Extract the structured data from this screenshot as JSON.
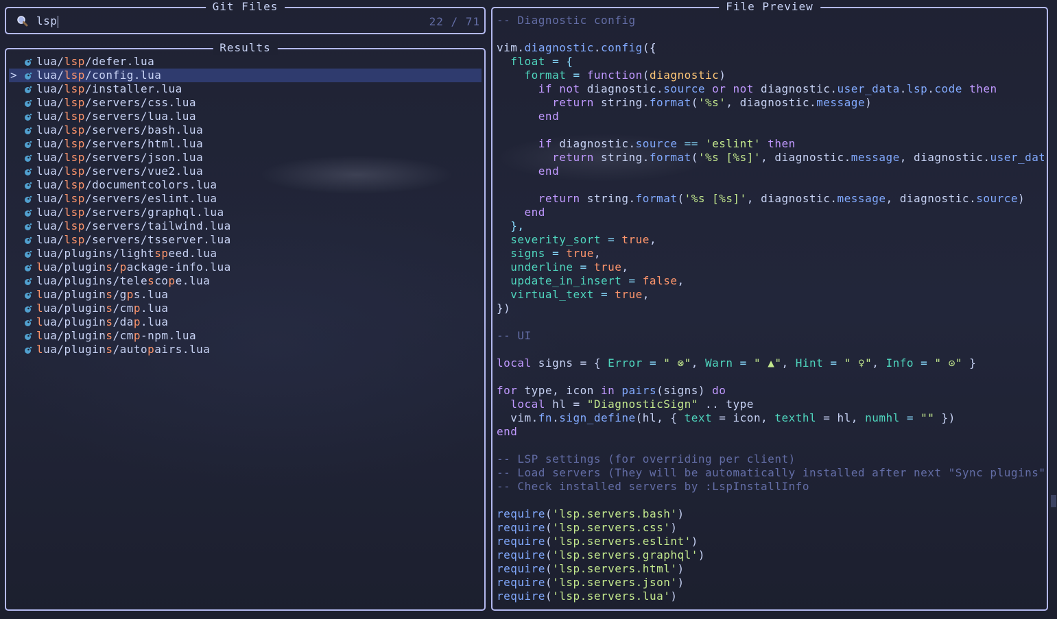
{
  "prompt": {
    "title": "Git Files",
    "query": "lsp",
    "counter": "22 / 71"
  },
  "results": {
    "title": "Results",
    "selected_index": 1,
    "items": [
      {
        "pre": "lua/",
        "hl": "lsp",
        "post": "/defer.lua"
      },
      {
        "pre": "lua/",
        "hl": "lsp",
        "post": "/config.lua"
      },
      {
        "pre": "lua/",
        "hl": "lsp",
        "post": "/installer.lua"
      },
      {
        "pre": "lua/",
        "hl": "lsp",
        "post": "/servers/css.lua"
      },
      {
        "pre": "lua/",
        "hl": "lsp",
        "post": "/servers/lua.lua"
      },
      {
        "pre": "lua/",
        "hl": "lsp",
        "post": "/servers/bash.lua"
      },
      {
        "pre": "lua/",
        "hl": "lsp",
        "post": "/servers/html.lua"
      },
      {
        "pre": "lua/",
        "hl": "lsp",
        "post": "/servers/json.lua"
      },
      {
        "pre": "lua/",
        "hl": "lsp",
        "post": "/servers/vue2.lua"
      },
      {
        "pre": "lua/",
        "hl": "lsp",
        "post": "/documentcolors.lua"
      },
      {
        "pre": "lua/",
        "hl": "lsp",
        "post": "/servers/eslint.lua"
      },
      {
        "pre": "lua/",
        "hl": "lsp",
        "post": "/servers/graphql.lua"
      },
      {
        "pre": "lua/",
        "hl": "lsp",
        "post": "/servers/tailwind.lua"
      },
      {
        "pre": "lua/",
        "hl": "lsp",
        "post": "/servers/tsserver.lua"
      },
      {
        "segs": [
          [
            "lua/plugins/light",
            0
          ],
          [
            "sp",
            1
          ],
          [
            "eed.lua",
            0
          ]
        ]
      },
      {
        "segs": [
          [
            "l",
            1
          ],
          [
            "ua/plugin",
            0
          ],
          [
            "s",
            1
          ],
          [
            "/",
            0
          ],
          [
            "p",
            1
          ],
          [
            "ackage-info.lua",
            0
          ]
        ]
      },
      {
        "segs": [
          [
            "lua/plugins/tele",
            0
          ],
          [
            "s",
            1
          ],
          [
            "co",
            0
          ],
          [
            "p",
            1
          ],
          [
            "e.lua",
            0
          ]
        ]
      },
      {
        "segs": [
          [
            "l",
            1
          ],
          [
            "ua/plugin",
            0
          ],
          [
            "s",
            1
          ],
          [
            "/g",
            0
          ],
          [
            "p",
            1
          ],
          [
            "s.lua",
            0
          ]
        ]
      },
      {
        "segs": [
          [
            "l",
            1
          ],
          [
            "ua/plugin",
            0
          ],
          [
            "s",
            1
          ],
          [
            "/cm",
            0
          ],
          [
            "p",
            1
          ],
          [
            ".lua",
            0
          ]
        ]
      },
      {
        "segs": [
          [
            "l",
            1
          ],
          [
            "ua/plugin",
            0
          ],
          [
            "s",
            1
          ],
          [
            "/da",
            0
          ],
          [
            "p",
            1
          ],
          [
            ".lua",
            0
          ]
        ]
      },
      {
        "segs": [
          [
            "l",
            1
          ],
          [
            "ua/plugin",
            0
          ],
          [
            "s",
            1
          ],
          [
            "/cm",
            0
          ],
          [
            "p",
            1
          ],
          [
            "-npm.lua",
            0
          ]
        ]
      },
      {
        "segs": [
          [
            "l",
            1
          ],
          [
            "ua/plugin",
            0
          ],
          [
            "s",
            1
          ],
          [
            "/auto",
            0
          ],
          [
            "p",
            1
          ],
          [
            "airs.lua",
            0
          ]
        ]
      }
    ]
  },
  "preview": {
    "title": "File Preview",
    "lines": [
      [
        [
          "-- Diagnostic config",
          "com"
        ]
      ],
      [],
      [
        [
          "vim",
          "var"
        ],
        [
          ".",
          "txt"
        ],
        [
          "diagnostic",
          "fn"
        ],
        [
          ".",
          "txt"
        ],
        [
          "config",
          "fn"
        ],
        [
          "({",
          "txt"
        ]
      ],
      [
        [
          "  float",
          "prop"
        ],
        [
          " = {",
          "op"
        ]
      ],
      [
        [
          "    format",
          "prop"
        ],
        [
          " = ",
          "op"
        ],
        [
          "function",
          "kw"
        ],
        [
          "(",
          "txt"
        ],
        [
          "diagnostic",
          "param"
        ],
        [
          ")",
          "txt"
        ]
      ],
      [
        [
          "      ",
          "txt"
        ],
        [
          "if not",
          "kw"
        ],
        [
          " diagnostic.",
          "txt"
        ],
        [
          "source",
          "field"
        ],
        [
          " ",
          "txt"
        ],
        [
          "or not",
          "kw"
        ],
        [
          " diagnostic.",
          "txt"
        ],
        [
          "user_data",
          "field"
        ],
        [
          ".",
          "txt"
        ],
        [
          "lsp",
          "field"
        ],
        [
          ".",
          "txt"
        ],
        [
          "code",
          "field"
        ],
        [
          " then",
          "kw"
        ]
      ],
      [
        [
          "        ",
          "txt"
        ],
        [
          "return",
          "kw"
        ],
        [
          " string.",
          "txt"
        ],
        [
          "format",
          "fn"
        ],
        [
          "(",
          "txt"
        ],
        [
          "'%s'",
          "str"
        ],
        [
          ", diagnostic.",
          "txt"
        ],
        [
          "message",
          "field"
        ],
        [
          ")",
          "txt"
        ]
      ],
      [
        [
          "      end",
          "kw"
        ]
      ],
      [],
      [
        [
          "      ",
          "txt"
        ],
        [
          "if",
          "kw"
        ],
        [
          " diagnostic.",
          "txt"
        ],
        [
          "source",
          "field"
        ],
        [
          " == ",
          "op"
        ],
        [
          "'eslint'",
          "str"
        ],
        [
          " then",
          "kw"
        ]
      ],
      [
        [
          "        ",
          "txt"
        ],
        [
          "return",
          "kw"
        ],
        [
          " string.",
          "txt"
        ],
        [
          "format",
          "fn"
        ],
        [
          "(",
          "txt"
        ],
        [
          "'%s [%s]'",
          "str"
        ],
        [
          ", diagnostic.",
          "txt"
        ],
        [
          "message",
          "field"
        ],
        [
          ", diagnostic.",
          "txt"
        ],
        [
          "user_data",
          "field"
        ]
      ],
      [
        [
          "      end",
          "kw"
        ]
      ],
      [],
      [
        [
          "      ",
          "txt"
        ],
        [
          "return",
          "kw"
        ],
        [
          " string.",
          "txt"
        ],
        [
          "format",
          "fn"
        ],
        [
          "(",
          "txt"
        ],
        [
          "'%s [%s]'",
          "str"
        ],
        [
          ", diagnostic.",
          "txt"
        ],
        [
          "message",
          "field"
        ],
        [
          ", diagnostic.",
          "txt"
        ],
        [
          "source",
          "field"
        ],
        [
          ")",
          "txt"
        ]
      ],
      [
        [
          "    end",
          "kw"
        ]
      ],
      [
        [
          "  },",
          "op"
        ]
      ],
      [
        [
          "  severity_sort",
          "prop"
        ],
        [
          " = ",
          "op"
        ],
        [
          "true",
          "bool"
        ],
        [
          ",",
          "txt"
        ]
      ],
      [
        [
          "  signs",
          "prop"
        ],
        [
          " = ",
          "op"
        ],
        [
          "true",
          "bool"
        ],
        [
          ",",
          "txt"
        ]
      ],
      [
        [
          "  underline",
          "prop"
        ],
        [
          " = ",
          "op"
        ],
        [
          "true",
          "bool"
        ],
        [
          ",",
          "txt"
        ]
      ],
      [
        [
          "  update_in_insert",
          "prop"
        ],
        [
          " = ",
          "op"
        ],
        [
          "false",
          "bool"
        ],
        [
          ",",
          "txt"
        ]
      ],
      [
        [
          "  virtual_text",
          "prop"
        ],
        [
          " = ",
          "op"
        ],
        [
          "true",
          "bool"
        ],
        [
          ",",
          "txt"
        ]
      ],
      [
        [
          "})",
          "txt"
        ]
      ],
      [],
      [
        [
          "-- UI",
          "com"
        ]
      ],
      [],
      [
        [
          "local",
          "kw"
        ],
        [
          " signs = { ",
          "txt"
        ],
        [
          "Error",
          "prop"
        ],
        [
          " = ",
          "op"
        ],
        [
          "\" ⊗\"",
          "str"
        ],
        [
          ", ",
          "txt"
        ],
        [
          "Warn",
          "prop"
        ],
        [
          " = ",
          "op"
        ],
        [
          "\" ▲\"",
          "str"
        ],
        [
          ", ",
          "txt"
        ],
        [
          "Hint",
          "prop"
        ],
        [
          " = ",
          "op"
        ],
        [
          "\" ♀\"",
          "str"
        ],
        [
          ", ",
          "txt"
        ],
        [
          "Info",
          "prop"
        ],
        [
          " = ",
          "op"
        ],
        [
          "\" ⊙\"",
          "str"
        ],
        [
          " }",
          "txt"
        ]
      ],
      [],
      [
        [
          "for",
          "kw"
        ],
        [
          " type, icon ",
          "txt"
        ],
        [
          "in",
          "kw"
        ],
        [
          " ",
          "txt"
        ],
        [
          "pairs",
          "fn"
        ],
        [
          "(signs) ",
          "txt"
        ],
        [
          "do",
          "kw"
        ]
      ],
      [
        [
          "  ",
          "txt"
        ],
        [
          "local",
          "kw"
        ],
        [
          " hl = ",
          "txt"
        ],
        [
          "\"DiagnosticSign\"",
          "str"
        ],
        [
          " .. type",
          "txt"
        ]
      ],
      [
        [
          "  vim.",
          "txt"
        ],
        [
          "fn",
          "field"
        ],
        [
          ".",
          "txt"
        ],
        [
          "sign_define",
          "fn"
        ],
        [
          "(hl, { ",
          "txt"
        ],
        [
          "text",
          "prop"
        ],
        [
          " = icon, ",
          "txt"
        ],
        [
          "texthl",
          "prop"
        ],
        [
          " = hl, ",
          "txt"
        ],
        [
          "numhl",
          "prop"
        ],
        [
          " = ",
          "op"
        ],
        [
          "\"\"",
          "str"
        ],
        [
          " })",
          "txt"
        ]
      ],
      [
        [
          "end",
          "kw"
        ]
      ],
      [],
      [
        [
          "-- LSP settings (for overriding per client)",
          "com"
        ]
      ],
      [
        [
          "-- Load servers (They will be automatically installed after next \"Sync plugins\"",
          "com"
        ]
      ],
      [
        [
          "-- Check installed servers by :LspInstallInfo",
          "com"
        ]
      ],
      [],
      [
        [
          "require",
          "fn"
        ],
        [
          "(",
          "txt"
        ],
        [
          "'lsp.servers.bash'",
          "str"
        ],
        [
          ")",
          "txt"
        ]
      ],
      [
        [
          "require",
          "fn"
        ],
        [
          "(",
          "txt"
        ],
        [
          "'lsp.servers.css'",
          "str"
        ],
        [
          ")",
          "txt"
        ]
      ],
      [
        [
          "require",
          "fn"
        ],
        [
          "(",
          "txt"
        ],
        [
          "'lsp.servers.eslint'",
          "str"
        ],
        [
          ")",
          "txt"
        ]
      ],
      [
        [
          "require",
          "fn"
        ],
        [
          "(",
          "txt"
        ],
        [
          "'lsp.servers.graphql'",
          "str"
        ],
        [
          ")",
          "txt"
        ]
      ],
      [
        [
          "require",
          "fn"
        ],
        [
          "(",
          "txt"
        ],
        [
          "'lsp.servers.html'",
          "str"
        ],
        [
          ")",
          "txt"
        ]
      ],
      [
        [
          "require",
          "fn"
        ],
        [
          "(",
          "txt"
        ],
        [
          "'lsp.servers.json'",
          "str"
        ],
        [
          ")",
          "txt"
        ]
      ],
      [
        [
          "require",
          "fn"
        ],
        [
          "(",
          "txt"
        ],
        [
          "'lsp.servers.lua'",
          "str"
        ],
        [
          ")",
          "txt"
        ]
      ]
    ]
  },
  "colors": {
    "border": "#b4b9f0",
    "highlight": "#ff966c",
    "selection": "#2f3b6e",
    "lua_icon": "#51a0cf"
  },
  "icons": {
    "search": "search-icon",
    "file": "lua-file-icon",
    "caret": ">"
  }
}
